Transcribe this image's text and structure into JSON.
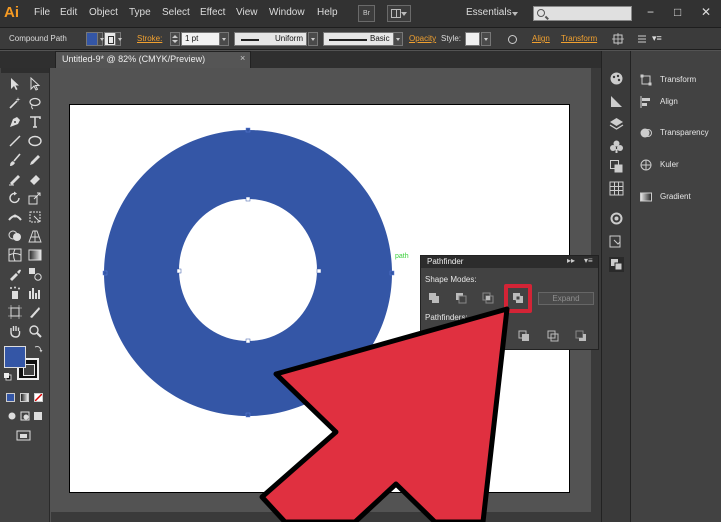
{
  "app": {
    "logo": "Ai"
  },
  "menu": [
    "File",
    "Edit",
    "Object",
    "Type",
    "Select",
    "Effect",
    "View",
    "Window",
    "Help"
  ],
  "menubar": {
    "bridge_label": "Br",
    "workspace": "Essentials"
  },
  "control_bar": {
    "selection_type": "Compound Path",
    "stroke_label": "Stroke:",
    "stroke_weight": "1 pt",
    "profile": "Uniform",
    "brush": "Basic",
    "opacity_label": "Opacity",
    "style_label": "Style:",
    "align_label": "Align",
    "transform_label": "Transform"
  },
  "document": {
    "tab_title": "Untitled-9* @ 82% (CMYK/Preview)",
    "close": "×"
  },
  "canvas": {
    "path_hint": "path",
    "shape_color": "#3456a6"
  },
  "dock_panels": [
    "Transform",
    "Align",
    "Transparency",
    "Kuler",
    "Gradient"
  ],
  "pathfinder": {
    "title": "Pathfinder",
    "shape_modes_label": "Shape Modes:",
    "pathfinders_label": "Pathfinders:",
    "expand_label": "Expand",
    "highlighted_button": "exclude",
    "highlight_color": "#d32436"
  },
  "colors": {
    "fill": "#3456a6",
    "accent": "#f0a030",
    "callout_arrow": "#e03040"
  }
}
